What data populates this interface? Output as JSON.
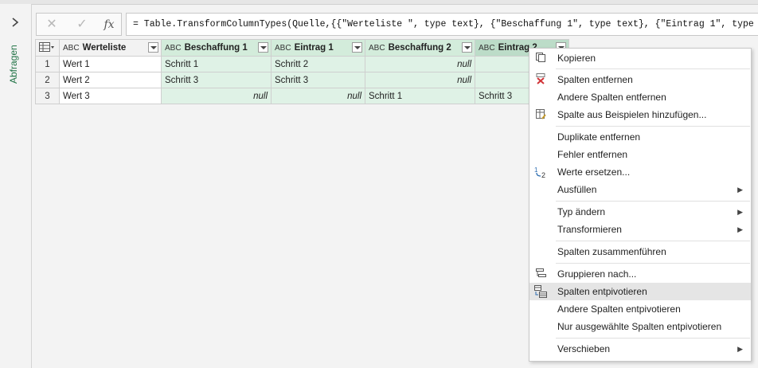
{
  "sidebar": {
    "label": "Abfragen"
  },
  "formula": {
    "cancel": "✕",
    "commit": "✓",
    "fx": "fx",
    "text": "= Table.TransformColumnTypes(Quelle,{{\"Werteliste \", type text}, {\"Beschaffung 1\", type text}, {\"Eintrag 1\", type text}, {\"Eintrag 2\", type text}"
  },
  "table": {
    "type_icon": "ABC",
    "columns": [
      "Werteliste",
      "Beschaffung 1",
      "Eintrag 1",
      "Beschaffung 2",
      "Eintrag 2"
    ],
    "rows": [
      {
        "n": "1",
        "cells": [
          "Wert 1",
          "Schritt 1",
          "Schritt 2",
          "null",
          ""
        ]
      },
      {
        "n": "2",
        "cells": [
          "Wert 2",
          "Schritt 3",
          "Schritt 3",
          "null",
          ""
        ]
      },
      {
        "n": "3",
        "cells": [
          "Wert 3",
          "null",
          "null",
          "Schritt 1",
          "Schritt 3"
        ]
      }
    ]
  },
  "menu": {
    "copy": "Kopieren",
    "remove_cols": "Spalten entfernen",
    "remove_other": "Andere Spalten entfernen",
    "add_example": "Spalte aus Beispielen hinzufügen...",
    "remove_dupes": "Duplikate entfernen",
    "remove_errors": "Fehler entfernen",
    "replace_values": "Werte ersetzen...",
    "fill": "Ausfüllen",
    "change_type": "Typ ändern",
    "transform": "Transformieren",
    "merge_cols": "Spalten zusammenführen",
    "group_by": "Gruppieren nach...",
    "unpivot": "Spalten entpivotieren",
    "unpivot_other": "Andere Spalten entpivotieren",
    "unpivot_selected": "Nur ausgewählte Spalten entpivotieren",
    "move": "Verschieben"
  },
  "colors": {
    "accent": "#217346",
    "selected_header": "#d3ecdb",
    "selected_cell": "#dff2e6",
    "menu_highlight": "#e5e5e5"
  }
}
